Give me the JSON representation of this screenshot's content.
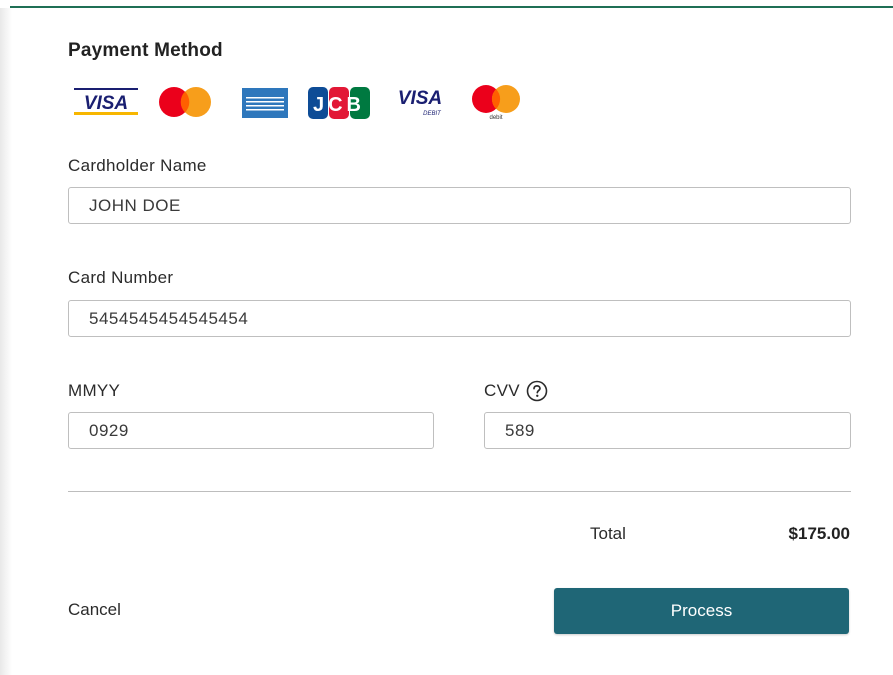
{
  "form": {
    "title": "Payment Method",
    "card_logos": [
      {
        "icon": "visa-logo",
        "text": "VISA"
      },
      {
        "icon": "mastercard-logo"
      },
      {
        "icon": "american-express-logo"
      },
      {
        "icon": "jcb-logo",
        "text": "JCB"
      },
      {
        "icon": "visa-debit-logo",
        "text": "VISA",
        "subtext": "DEBIT"
      },
      {
        "icon": "mastercard-debit-logo",
        "subtext": "debit"
      }
    ],
    "cardholder": {
      "label": "Cardholder Name",
      "value": "JOHN DOE"
    },
    "card_number": {
      "label": "Card Number",
      "value": "5454545454545454"
    },
    "expiry": {
      "label": "MMYY",
      "value": "0929"
    },
    "cvv": {
      "label": "CVV",
      "value": "589",
      "help_icon": "question-circle-icon"
    },
    "total": {
      "label": "Total",
      "value": "$175.00"
    },
    "actions": {
      "cancel_label": "Cancel",
      "process_label": "Process"
    }
  },
  "colors": {
    "accent": "#1f6676",
    "top_rule": "#1f6f55",
    "visa_blue": "#1a1f71",
    "visa_gold": "#f7b600",
    "mastercard_red": "#eb001b",
    "mastercard_orange": "#f79e1b",
    "amex_blue": "#2e77bc"
  }
}
